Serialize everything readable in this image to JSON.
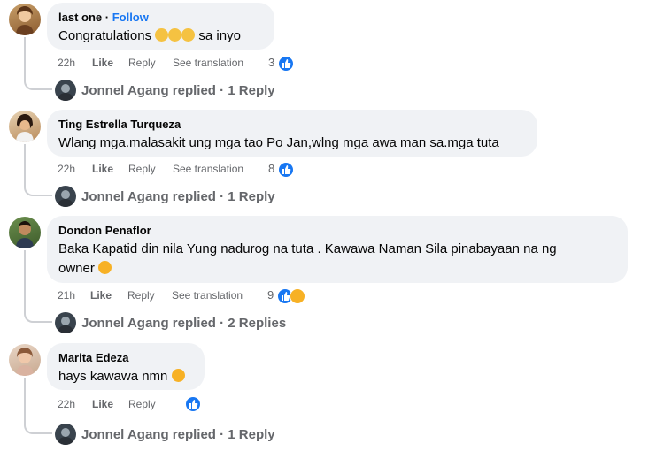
{
  "comments": [
    {
      "author": "last one",
      "follow": "Follow",
      "text": "Congratulations",
      "text_suffix": "sa inyo",
      "time": "22h",
      "like": "Like",
      "reply": "Reply",
      "see_translation": "See translation",
      "reaction_count": "3",
      "replies": "Jonnel Agang replied · 1 Reply"
    },
    {
      "author": "Ting Estrella Turqueza",
      "text": "Wlang mga.malasakit ung mga tao Po Jan,wlng mga awa man sa.mga tuta",
      "time": "22h",
      "like": "Like",
      "reply": "Reply",
      "see_translation": "See translation",
      "reaction_count": "8",
      "replies": "Jonnel Agang replied · 1 Reply"
    },
    {
      "author": "Dondon Penaflor",
      "text_line1": "Baka Kapatid din nila Yung nadurog na tuta . Kawawa Naman Sila pinabayaan na ng",
      "text_line2": "owner",
      "time": "21h",
      "like": "Like",
      "reply": "Reply",
      "see_translation": "See translation",
      "reaction_count": "9",
      "replies": "Jonnel Agang replied · 2 Replies"
    },
    {
      "author": "Marita Edeza",
      "text": "hays kawawa nmn",
      "time": "22h",
      "like": "Like",
      "reply": "Reply",
      "replies": "Jonnel Agang replied · 1 Reply"
    }
  ],
  "colors": {
    "accent": "#1877f2",
    "bubble": "#f0f2f5",
    "muted": "#65676b",
    "sad": "#f7b125"
  },
  "icons": [
    "like-icon",
    "sad-icon",
    "clap-emoji",
    "sad-emoji"
  ]
}
